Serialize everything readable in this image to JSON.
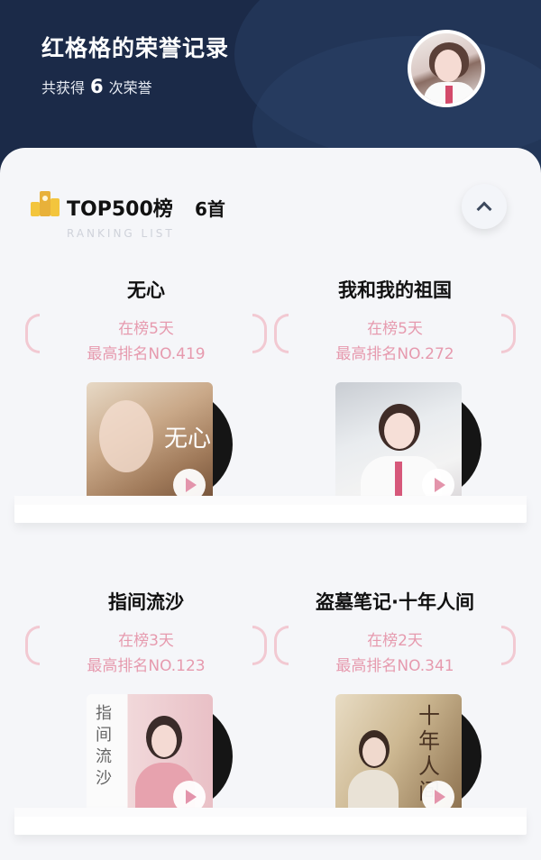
{
  "header": {
    "title": "红格格的荣誉记录",
    "subtitle_prefix": "共获得",
    "count": "6",
    "subtitle_suffix": "次荣誉"
  },
  "section": {
    "title": "TOP500榜",
    "count_label": "6首",
    "subtitle": "RANKING LIST",
    "collapse_icon": "chevron-up-icon"
  },
  "songs": [
    {
      "name": "无心",
      "days": "在榜5天",
      "rank": "最高排名NO.419",
      "cover_text": "无心"
    },
    {
      "name": "我和我的祖国",
      "days": "在榜5天",
      "rank": "最高排名NO.272",
      "cover_text": ""
    },
    {
      "name": "指间流沙",
      "days": "在榜3天",
      "rank": "最高排名NO.123",
      "cover_text": "指间流沙"
    },
    {
      "name": "盗墓笔记·十年人间",
      "days": "在榜2天",
      "rank": "最高排名NO.341",
      "cover_text": "十年人间"
    }
  ],
  "colors": {
    "header_bg": "#1b2a48",
    "panel_bg": "#f5f6f9",
    "accent_pink": "#e69aae"
  }
}
